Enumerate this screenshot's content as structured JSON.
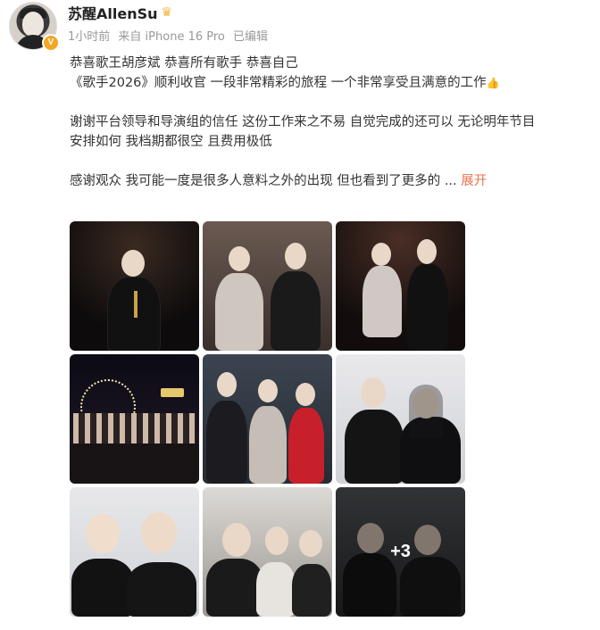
{
  "post": {
    "username": "苏醒AllenSu",
    "verified_badge": "V",
    "meta": {
      "time": "1小时前",
      "source": "来自 iPhone 16 Pro",
      "edited": "已编辑"
    },
    "text": {
      "line1": "恭喜歌王胡彦斌 恭喜所有歌手 恭喜自己",
      "line2": "《歌手2026》顺利收官 一段非常精彩的旅程 一个非常享受且满意的工作",
      "line3": "谢谢平台领导和导演组的信任 这份工作来之不易 自觉完成的还可以 无论明年节目",
      "line4": "安排如何 我档期都很空 且费用极低",
      "line5": "感谢观众 我可能一度是很多人意料之外的出现 但也看到了更多的 ...",
      "expand_link": "展开"
    },
    "images": {
      "extra_count": "+3"
    }
  },
  "colors": {
    "link": "#eb7350",
    "meta_text": "#999999",
    "badge": "#f6a623"
  }
}
